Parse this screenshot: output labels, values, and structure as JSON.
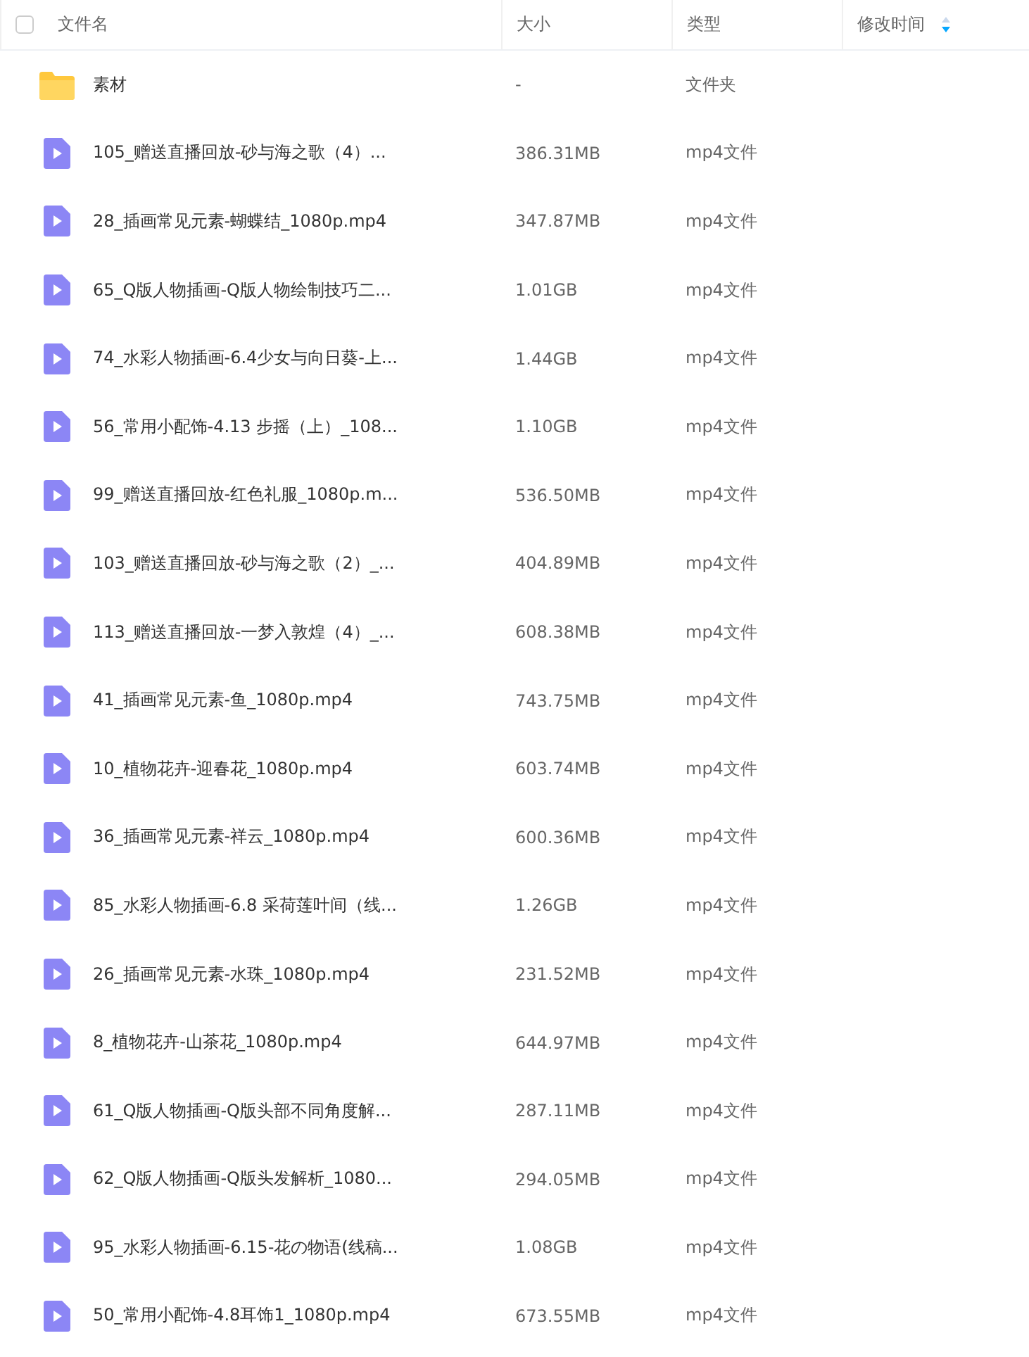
{
  "header": {
    "select_all_checked": false,
    "columns": [
      {
        "label": "文件名",
        "sorted": false
      },
      {
        "label": "大小",
        "sorted": false
      },
      {
        "label": "类型",
        "sorted": false
      },
      {
        "label": "修改时间",
        "sorted": true
      }
    ]
  },
  "rows": [
    {
      "kind": "folder",
      "name": "素材",
      "size": "-",
      "type": "文件夹"
    },
    {
      "kind": "video",
      "name": "105_赠送直播回放-砂与海之歌（4）...",
      "size": "386.31MB",
      "type": "mp4文件"
    },
    {
      "kind": "video",
      "name": "28_插画常见元素-蝴蝶结_1080p.mp4",
      "size": "347.87MB",
      "type": "mp4文件"
    },
    {
      "kind": "video",
      "name": "65_Q版人物插画-Q版人物绘制技巧二...",
      "size": "1.01GB",
      "type": "mp4文件"
    },
    {
      "kind": "video",
      "name": "74_水彩人物插画-6.4少女与向日葵-上...",
      "size": "1.44GB",
      "type": "mp4文件"
    },
    {
      "kind": "video",
      "name": "56_常用小配饰-4.13 步摇（上）_108...",
      "size": "1.10GB",
      "type": "mp4文件"
    },
    {
      "kind": "video",
      "name": "99_赠送直播回放-红色礼服_1080p.m...",
      "size": "536.50MB",
      "type": "mp4文件"
    },
    {
      "kind": "video",
      "name": "103_赠送直播回放-砂与海之歌（2）_...",
      "size": "404.89MB",
      "type": "mp4文件"
    },
    {
      "kind": "video",
      "name": "113_赠送直播回放-一梦入敦煌（4）_...",
      "size": "608.38MB",
      "type": "mp4文件"
    },
    {
      "kind": "video",
      "name": "41_插画常见元素-鱼_1080p.mp4",
      "size": "743.75MB",
      "type": "mp4文件"
    },
    {
      "kind": "video",
      "name": "10_植物花卉-迎春花_1080p.mp4",
      "size": "603.74MB",
      "type": "mp4文件"
    },
    {
      "kind": "video",
      "name": "36_插画常见元素-祥云_1080p.mp4",
      "size": "600.36MB",
      "type": "mp4文件"
    },
    {
      "kind": "video",
      "name": "85_水彩人物插画-6.8 采荷莲叶间（线...",
      "size": "1.26GB",
      "type": "mp4文件"
    },
    {
      "kind": "video",
      "name": "26_插画常见元素-水珠_1080p.mp4",
      "size": "231.52MB",
      "type": "mp4文件"
    },
    {
      "kind": "video",
      "name": "8_植物花卉-山茶花_1080p.mp4",
      "size": "644.97MB",
      "type": "mp4文件"
    },
    {
      "kind": "video",
      "name": "61_Q版人物插画-Q版头部不同角度解...",
      "size": "287.11MB",
      "type": "mp4文件"
    },
    {
      "kind": "video",
      "name": "62_Q版人物插画-Q版头发解析_1080...",
      "size": "294.05MB",
      "type": "mp4文件"
    },
    {
      "kind": "video",
      "name": "95_水彩人物插画-6.15-花の物语(线稿...",
      "size": "1.08GB",
      "type": "mp4文件"
    },
    {
      "kind": "video",
      "name": "50_常用小配饰-4.8耳饰1_1080p.mp4",
      "size": "673.55MB",
      "type": "mp4文件"
    }
  ]
}
